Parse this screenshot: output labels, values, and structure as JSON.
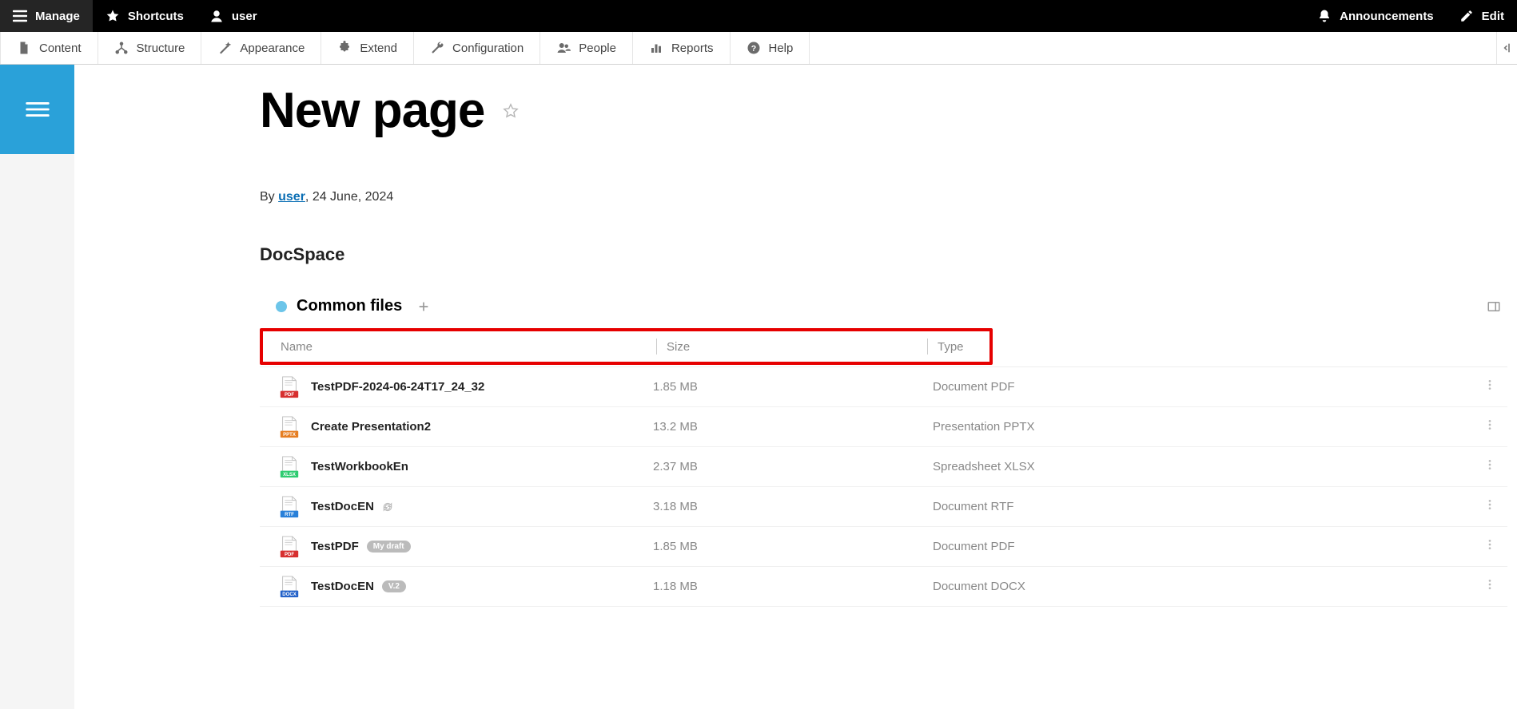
{
  "topbar": {
    "manage": "Manage",
    "shortcuts": "Shortcuts",
    "user": "user",
    "announcements": "Announcements",
    "edit": "Edit"
  },
  "adminmenu": {
    "content": "Content",
    "structure": "Structure",
    "appearance": "Appearance",
    "extend": "Extend",
    "configuration": "Configuration",
    "people": "People",
    "reports": "Reports",
    "help": "Help"
  },
  "page": {
    "title": "New page",
    "by_prefix": "By ",
    "author": "user",
    "date_sep": ", ",
    "date": "24 June, 2024"
  },
  "section": {
    "title": "DocSpace"
  },
  "docspace": {
    "title": "Common files",
    "columns": {
      "name": "Name",
      "size": "Size",
      "type": "Type"
    },
    "files": [
      {
        "icon": "pdf",
        "name": "TestPDF-2024-06-24T17_24_32",
        "size": "1.85 MB",
        "type": "Document PDF",
        "badge": null,
        "refresh": false
      },
      {
        "icon": "pptx",
        "name": "Create Presentation2",
        "size": "13.2 MB",
        "type": "Presentation PPTX",
        "badge": null,
        "refresh": false
      },
      {
        "icon": "xlsx",
        "name": "TestWorkbookEn",
        "size": "2.37 MB",
        "type": "Spreadsheet XLSX",
        "badge": null,
        "refresh": false
      },
      {
        "icon": "rtf",
        "name": "TestDocEN",
        "size": "3.18 MB",
        "type": "Document RTF",
        "badge": null,
        "refresh": true
      },
      {
        "icon": "pdf",
        "name": "TestPDF",
        "size": "1.85 MB",
        "type": "Document PDF",
        "badge": "My draft",
        "refresh": false
      },
      {
        "icon": "docx",
        "name": "TestDocEN",
        "size": "1.18 MB",
        "type": "Document DOCX",
        "badge": "V.2",
        "refresh": false
      }
    ]
  }
}
